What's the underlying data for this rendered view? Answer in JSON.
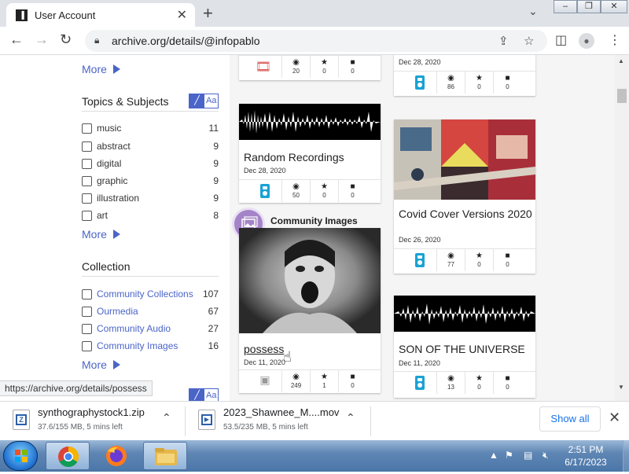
{
  "browser": {
    "tab_title": "User Account",
    "url": "archive.org/details/@infopablo",
    "status_url": "https://archive.org/details/possess"
  },
  "sidebar": {
    "more_label": "More",
    "topics_title": "Topics & Subjects",
    "toggle_text": "Aa",
    "topics": [
      {
        "label": "music",
        "count": "11"
      },
      {
        "label": "abstract",
        "count": "9"
      },
      {
        "label": "digital",
        "count": "9"
      },
      {
        "label": "graphic",
        "count": "9"
      },
      {
        "label": "illustration",
        "count": "9"
      },
      {
        "label": "art",
        "count": "8"
      }
    ],
    "collection_title": "Collection",
    "collections": [
      {
        "label": "Community Collections",
        "count": "107"
      },
      {
        "label": "Ourmedia",
        "count": "67"
      },
      {
        "label": "Community Audio",
        "count": "27"
      },
      {
        "label": "Community Images",
        "count": "16"
      }
    ]
  },
  "items": {
    "top_left": {
      "views": "20",
      "favs": "0",
      "reviews": "0",
      "type_icon": "film-icon"
    },
    "top_right": {
      "date": "Dec 28, 2020",
      "views": "86",
      "favs": "0",
      "reviews": "0",
      "type_icon": "audio-icon"
    },
    "random": {
      "title": "Random Recordings",
      "date": "Dec 28, 2020",
      "views": "50",
      "favs": "0",
      "reviews": "0",
      "type_icon": "audio-icon"
    },
    "covid": {
      "title": "Covid Cover Versions 2020",
      "date": "Dec 26, 2020",
      "views": "77",
      "favs": "0",
      "reviews": "0",
      "type_icon": "audio-icon"
    },
    "community_label": "Community Images",
    "possess": {
      "title": "possess",
      "date": "Dec 11, 2020",
      "views": "249",
      "favs": "1",
      "reviews": "0",
      "type_icon": "image-icon"
    },
    "son": {
      "title": "SON OF THE UNIVERSE",
      "date": "Dec 11, 2020",
      "views": "13",
      "favs": "0",
      "reviews": "0",
      "type_icon": "audio-icon"
    }
  },
  "downloads": {
    "items": [
      {
        "name": "synthographystock1.zip",
        "status": "37.6/155 MB, 5 mins left"
      },
      {
        "name": "2023_Shawnee_M....mov",
        "status": "53.5/235 MB, 5 mins left"
      }
    ],
    "show_all": "Show all"
  },
  "taskbar": {
    "time": "2:51 PM",
    "date": "6/17/2023"
  },
  "colors": {
    "link": "#4b64c8",
    "audio": "#1aa2d4",
    "community_badge": "#a583c8",
    "film": "#d9534f"
  }
}
